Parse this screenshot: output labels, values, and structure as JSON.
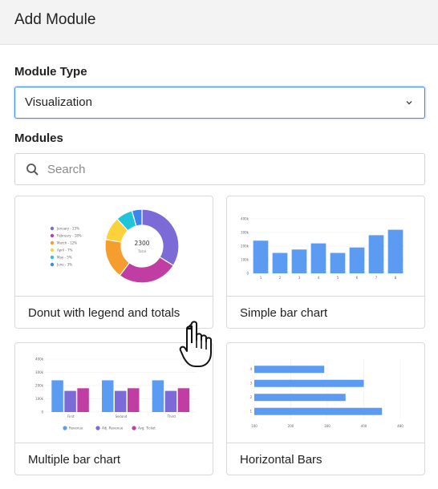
{
  "dialog": {
    "title": "Add Module"
  },
  "module_type": {
    "label": "Module Type",
    "selected": "Visualization"
  },
  "modules": {
    "label": "Modules",
    "search_placeholder": "Search"
  },
  "cards": [
    {
      "label": "Donut with legend and totals",
      "preview": {
        "legend": [
          "January - 23%",
          "February - 18%",
          "March - 12%",
          "April - 7%",
          "May - 5%",
          "June - 3%"
        ],
        "center_value": "2300",
        "center_label": "Total",
        "colors": [
          "#7c6ad6",
          "#c03ea3",
          "#f59e2e",
          "#fcd23b",
          "#22c4d9",
          "#3b86ee"
        ]
      }
    },
    {
      "label": "Simple bar chart",
      "preview": {
        "y_ticks": [
          "400k",
          "300k",
          "200k",
          "100k",
          "0"
        ],
        "x_ticks": [
          "1",
          "2",
          "3",
          "4",
          "5",
          "6",
          "7",
          "8"
        ],
        "values": [
          240,
          150,
          175,
          220,
          150,
          190,
          280,
          320
        ],
        "color": "#5b9cf2"
      }
    },
    {
      "label": "Multiple bar chart",
      "preview": {
        "y_ticks": [
          "400k",
          "300k",
          "200k",
          "100k",
          "0"
        ],
        "groups": [
          "First",
          "Second",
          "Third"
        ],
        "series_names": [
          "Revenue",
          "Adj. Revenue",
          "Avg. Ticket"
        ],
        "values": [
          [
            240,
            160,
            180
          ],
          [
            240,
            160,
            180
          ],
          [
            240,
            160,
            180
          ]
        ],
        "colors": [
          "#5b9cf2",
          "#7c6ad6",
          "#c03ea3"
        ]
      }
    },
    {
      "label": "Horizontal Bars",
      "preview": {
        "y_ticks": [
          "4",
          "3",
          "2",
          "1"
        ],
        "x_ticks": [
          "100",
          "200",
          "300",
          "400",
          "480"
        ],
        "values": [
          230,
          360,
          300,
          420
        ],
        "color": "#5b9cf2"
      }
    }
  ]
}
